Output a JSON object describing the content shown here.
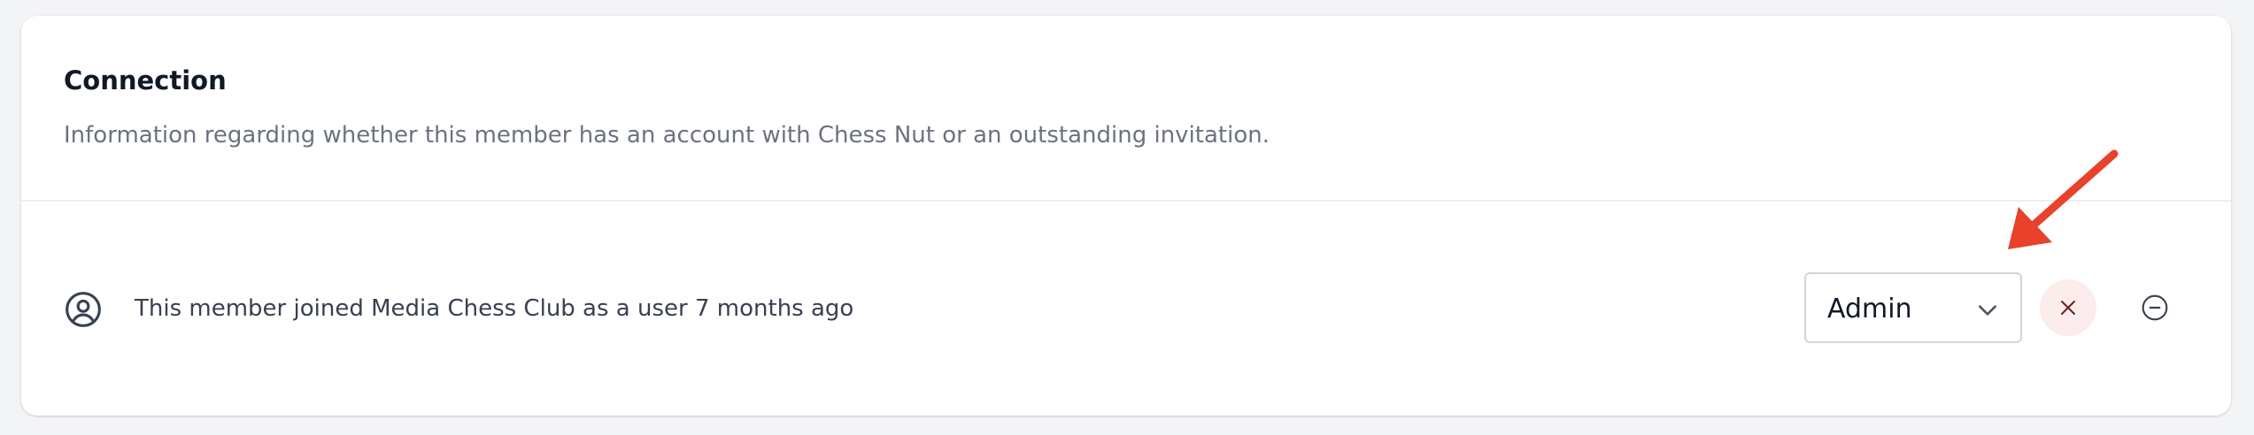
{
  "section": {
    "title": "Connection",
    "description": "Information regarding whether this member has an account with Chess Nut or an outstanding invitation."
  },
  "member": {
    "status_text": "This member joined Media Chess Club as a user 7 months ago",
    "icon": "user-circle-icon"
  },
  "role": {
    "selected": "Admin",
    "icon": "chevron-down-icon"
  },
  "actions": {
    "cancel_icon": "x-icon",
    "remove_icon": "minus-circle-icon"
  },
  "annotation": {
    "arrow_color": "#e8412c"
  },
  "colors": {
    "cancel_bg": "#fdecec",
    "card_bg": "#ffffff",
    "page_bg": "#f3f4f6"
  }
}
